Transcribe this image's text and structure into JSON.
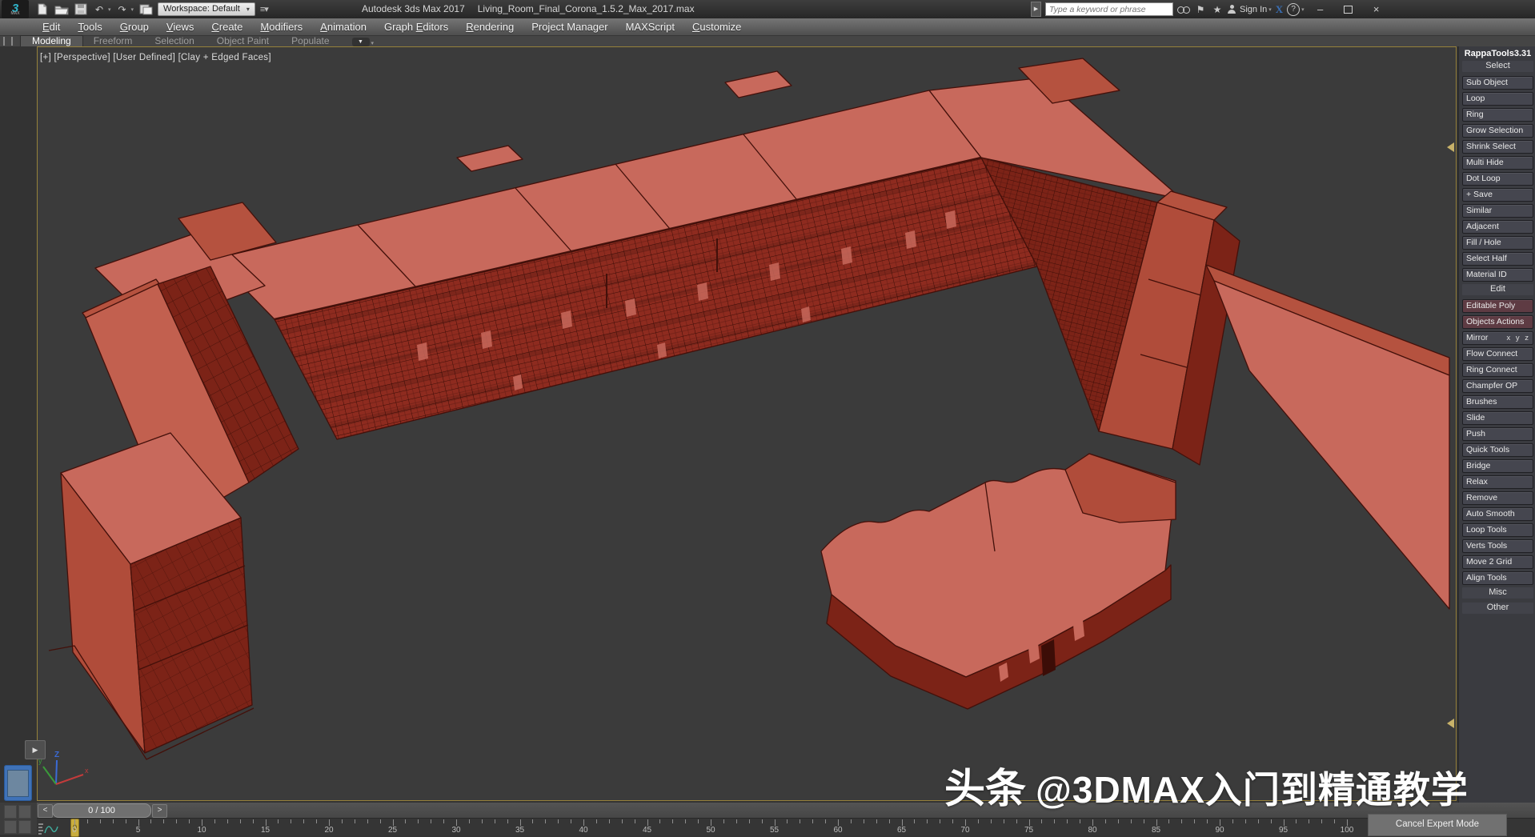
{
  "window": {
    "app_title": "Autodesk 3ds Max 2017",
    "file_name": "Living_Room_Final_Corona_1.5.2_Max_2017.max"
  },
  "quick_access": {
    "workspace_label": "Workspace: Default"
  },
  "search": {
    "placeholder": "Type a keyword or phrase",
    "sign_in_label": "Sign In"
  },
  "menu": {
    "items": [
      {
        "label": "Edit",
        "u_index": 0
      },
      {
        "label": "Tools",
        "u_index": 0
      },
      {
        "label": "Group",
        "u_index": 0
      },
      {
        "label": "Views",
        "u_index": 0
      },
      {
        "label": "Create",
        "u_index": 0
      },
      {
        "label": "Modifiers",
        "u_index": 0
      },
      {
        "label": "Animation",
        "u_index": 0
      },
      {
        "label": "Graph Editors",
        "u_index": 6
      },
      {
        "label": "Rendering",
        "u_index": 0
      },
      {
        "label": "Project Manager",
        "u_index": -1
      },
      {
        "label": "MAXScript",
        "u_index": -1
      },
      {
        "label": "Customize",
        "u_index": 0
      }
    ]
  },
  "ribbon": {
    "tabs": [
      "Modeling",
      "Freeform",
      "Selection",
      "Object Paint",
      "Populate"
    ],
    "active": "Modeling"
  },
  "viewport": {
    "label": "[+] [Perspective] [User Defined] [Clay + Edged Faces]"
  },
  "axis_gizmo": {
    "x": "x",
    "y": "y",
    "z": "Z"
  },
  "rappatools": {
    "title": "RappaTools3.31",
    "items": [
      {
        "type": "section",
        "label": "Select"
      },
      {
        "type": "button",
        "label": "Sub Object"
      },
      {
        "type": "button",
        "label": "Loop"
      },
      {
        "type": "button",
        "label": "Ring"
      },
      {
        "type": "button",
        "label": "Grow Selection"
      },
      {
        "type": "button",
        "label": "Shrink Select"
      },
      {
        "type": "button",
        "label": "Multi Hide"
      },
      {
        "type": "button",
        "label": "Dot Loop"
      },
      {
        "type": "button",
        "label": "+ Save"
      },
      {
        "type": "button",
        "label": "Similar"
      },
      {
        "type": "button",
        "label": "Adjacent"
      },
      {
        "type": "button",
        "label": "Fill / Hole"
      },
      {
        "type": "button",
        "label": "Select Half"
      },
      {
        "type": "button",
        "label": "Material ID"
      },
      {
        "type": "section",
        "label": "Edit"
      },
      {
        "type": "button",
        "label": "Editable Poly",
        "variant": "maroon"
      },
      {
        "type": "button",
        "label": "Objects Actions",
        "variant": "maroon"
      },
      {
        "type": "button",
        "label": "Mirror",
        "extra": "x y z"
      },
      {
        "type": "button",
        "label": "Flow Connect"
      },
      {
        "type": "button",
        "label": "Ring Connect"
      },
      {
        "type": "button",
        "label": "Champfer OP"
      },
      {
        "type": "button",
        "label": "Brushes"
      },
      {
        "type": "button",
        "label": "Slide"
      },
      {
        "type": "button",
        "label": "Push"
      },
      {
        "type": "button",
        "label": "Quick Tools"
      },
      {
        "type": "button",
        "label": "Bridge"
      },
      {
        "type": "button",
        "label": "Relax"
      },
      {
        "type": "button",
        "label": "Remove"
      },
      {
        "type": "button",
        "label": "Auto Smooth"
      },
      {
        "type": "button",
        "label": "Loop Tools"
      },
      {
        "type": "button",
        "label": "Verts Tools"
      },
      {
        "type": "button",
        "label": "Move 2 Grid"
      },
      {
        "type": "button",
        "label": "Align Tools"
      },
      {
        "type": "section",
        "label": "Misc"
      },
      {
        "type": "section",
        "label": "Other"
      }
    ]
  },
  "timeline": {
    "frame_display": "0 / 100",
    "prev_label": "<",
    "next_label": ">",
    "current_frame": "0",
    "tick_labels": [
      "0",
      "5",
      "10",
      "15",
      "20",
      "25",
      "30",
      "35",
      "40",
      "45",
      "50",
      "55",
      "60",
      "65",
      "70",
      "75",
      "80",
      "85",
      "90",
      "95",
      "100"
    ]
  },
  "expert_mode": {
    "cancel_label": "Cancel Expert Mode"
  },
  "watermark": {
    "prefix": "头条",
    "handle": "@3DMAX入门到精通教学"
  },
  "colors": {
    "accent_yellow_border": "#96813b",
    "frame_marker": "#c9ad3d",
    "viewport_bg": "#3b3b3b",
    "clay_roof": "#c8695c",
    "clay_roof_dim": "#b5523f",
    "clay_wall_light": "#c2604f",
    "clay_wall_mid": "#b04c3a",
    "clay_facade": "#8e2b1f",
    "clay_facade_dark": "#7c2317",
    "clay_edge": "#43100a",
    "clay_wire": "#3c0d07",
    "panel_button": "#45464f",
    "panel_button_maroon": "#5e3b43",
    "exchange_blue": "#3a6fb5"
  }
}
